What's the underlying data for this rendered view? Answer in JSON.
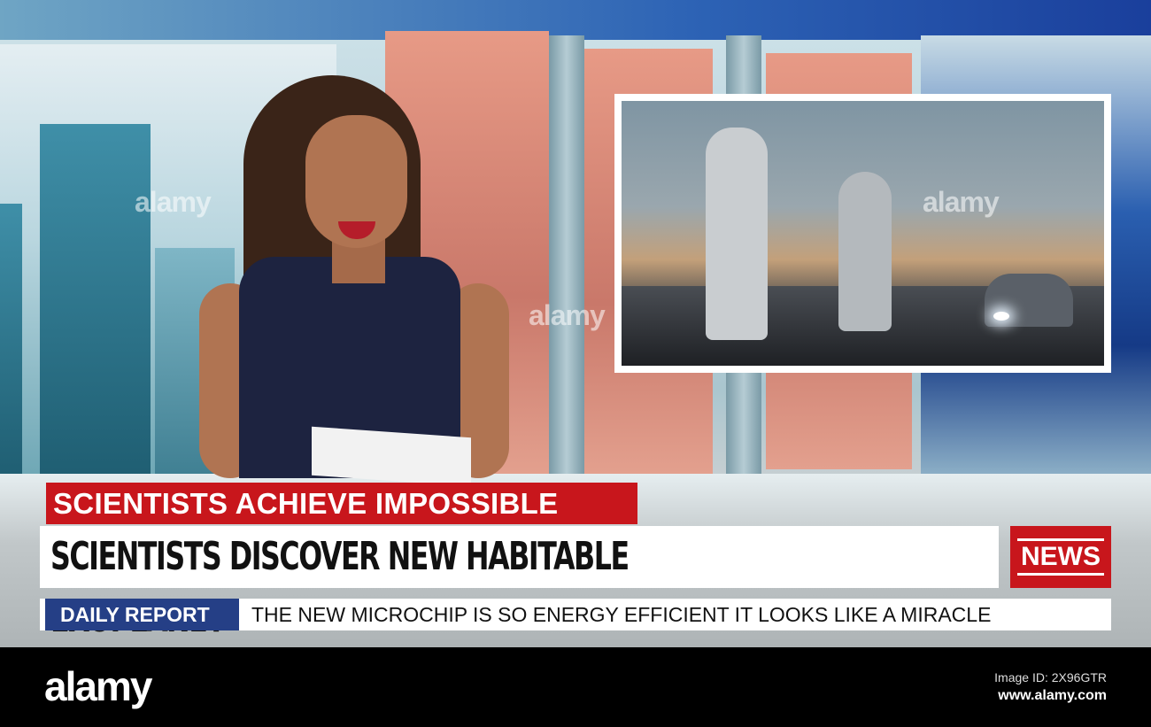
{
  "lower_third": {
    "category": "SCIENTISTS ACHIEVE IMPOSSIBLE",
    "headline": "SCIENTISTS DISCOVER NEW HABITABLE EXOPLANET",
    "badge": "NEWS"
  },
  "ticker": {
    "label": "DAILY REPORT",
    "text": "THE NEW MICROCHIP IS SO ENERGY EFFICIENT IT LOOKS LIKE A MIRACLE"
  },
  "watermark": "alamy",
  "footer": {
    "logo": "alamy",
    "image_id": "Image ID: 2X96GTR",
    "site": "www.alamy.com"
  },
  "colors": {
    "red": "#c8161c",
    "blue": "#253f86"
  }
}
